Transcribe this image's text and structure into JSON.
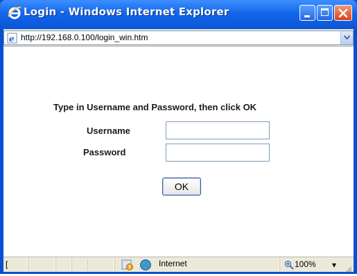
{
  "window": {
    "title": "Login - Windows Internet Explorer",
    "colors": {
      "titlebar": "#1366ea",
      "close": "#d8421a",
      "frame": "#0b4fd1"
    }
  },
  "address": {
    "url": "http://192.168.0.100/login_win.htm"
  },
  "form": {
    "prompt": "Type in Username and Password, then click OK",
    "username_label": "Username",
    "password_label": "Password",
    "username_value": "",
    "password_value": "",
    "ok_label": "OK"
  },
  "status": {
    "left_text": "[",
    "zone": "Internet",
    "zoom": "100%",
    "zoom_arrow": "▾"
  },
  "icons": [
    "ie-logo-icon",
    "page-icon",
    "dropdown-arrow-icon",
    "protected-mode-warning-icon",
    "globe-icon",
    "zoom-icon",
    "resize-grip-icon"
  ]
}
